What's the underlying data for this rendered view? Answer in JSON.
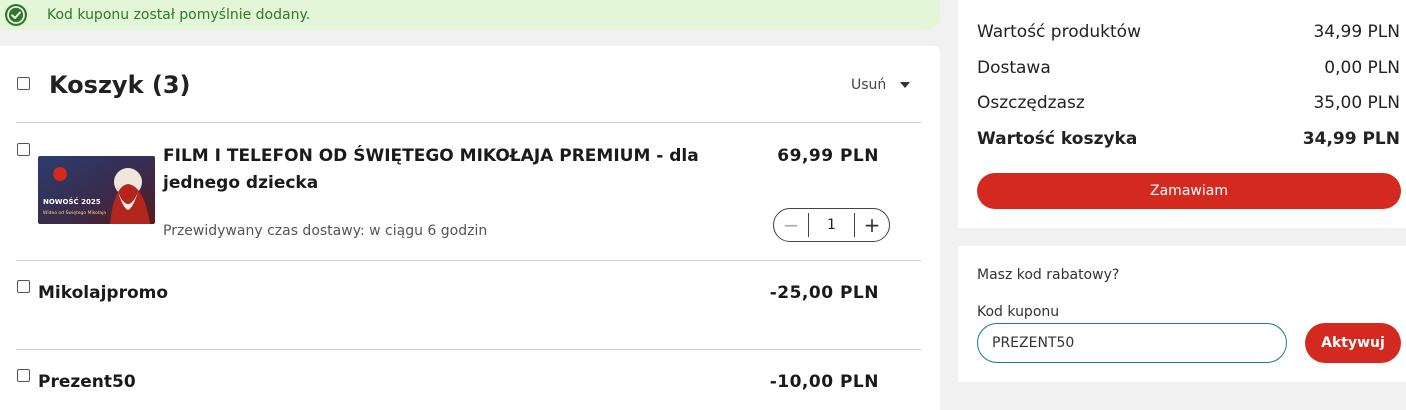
{
  "alert": {
    "message": "Kod kuponu został pomyślnie dodany.",
    "icon": "check-circle-icon",
    "color": "#2f7a2a"
  },
  "cart": {
    "title": "Koszyk (3)",
    "remove_label": "Usuń",
    "product": {
      "name": "FILM I TELEFON OD ŚWIĘTEGO MIKOŁAJA PREMIUM - dla jednego dziecka",
      "price": "69,99 PLN",
      "delivery": "Przewidywany czas dostawy: w ciągu 6 godzin",
      "quantity": "1",
      "thumb_badge": "NOWOŚĆ 2025",
      "thumb_caption": "Wideo od Świętego Mikołaja"
    },
    "discounts": [
      {
        "name": "Mikolajpromo",
        "value": "-25,00 PLN"
      },
      {
        "name": "Prezent50",
        "value": "-10,00 PLN"
      }
    ]
  },
  "summary": {
    "rows": [
      {
        "label": "Wartość produktów",
        "value": "34,99 PLN"
      },
      {
        "label": "Dostawa",
        "value": "0,00 PLN"
      },
      {
        "label": "Oszczędzasz",
        "value": "35,00 PLN"
      },
      {
        "label": "Wartość koszyka",
        "value": "34,99 PLN"
      }
    ],
    "order_label": "Zamawiam"
  },
  "coupon": {
    "question": "Masz kod rabatowy?",
    "field_label": "Kod kuponu",
    "field_value": "PREZENT50",
    "activate_label": "Aktywuj"
  },
  "colors": {
    "accent": "#d4291f",
    "success_bg": "#e3f6d8",
    "input_border": "#1a7a8a"
  }
}
